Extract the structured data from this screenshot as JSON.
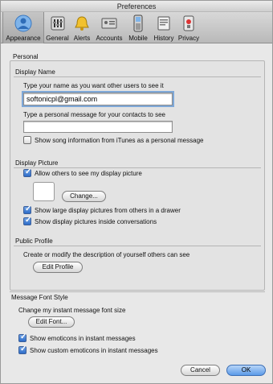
{
  "window": {
    "title": "Preferences"
  },
  "toolbar": {
    "items": [
      {
        "label": "Appearance",
        "icon": "person-silhouette-icon",
        "selected": true
      },
      {
        "label": "General",
        "icon": "switch-panel-icon"
      },
      {
        "label": "Alerts",
        "icon": "bell-icon"
      },
      {
        "label": "Accounts",
        "icon": "accounts-icon"
      },
      {
        "label": "Mobile",
        "icon": "mobile-phone-icon"
      },
      {
        "label": "History",
        "icon": "history-book-icon"
      },
      {
        "label": "Privacy",
        "icon": "privacy-lock-icon"
      }
    ]
  },
  "personal": {
    "title": "Personal",
    "display_name": {
      "title": "Display Name",
      "name_prompt": "Type your name as you want other users to see it",
      "name_value": "softonicpl@gmail.com",
      "message_prompt": "Type a personal message for your contacts to see",
      "message_value": "",
      "show_song_label": "Show song information from iTunes as a personal message",
      "show_song_checked": false
    },
    "display_picture": {
      "title": "Display Picture",
      "allow_others_label": "Allow others to see my display picture",
      "allow_others_checked": true,
      "change_button": "Change...",
      "show_large_label": "Show large display pictures from others in a drawer",
      "show_large_checked": true,
      "show_inside_label": "Show display pictures inside conversations",
      "show_inside_checked": true
    },
    "public_profile": {
      "title": "Public Profile",
      "description": "Create or modify the description of yourself others can see",
      "edit_button": "Edit Profile"
    }
  },
  "message_font": {
    "title": "Message Font Style",
    "description": "Change my instant message font size",
    "edit_font_button": "Edit Font...",
    "show_emoticons_label": "Show emoticons in instant messages",
    "show_emoticons_checked": true,
    "show_custom_label": "Show custom emoticons in instant messages",
    "show_custom_checked": true
  },
  "footer": {
    "cancel_button": "Cancel",
    "ok_button": "OK"
  },
  "colors": {
    "accent": "#5a9ae8",
    "focus_ring": "#7ea8d8"
  }
}
